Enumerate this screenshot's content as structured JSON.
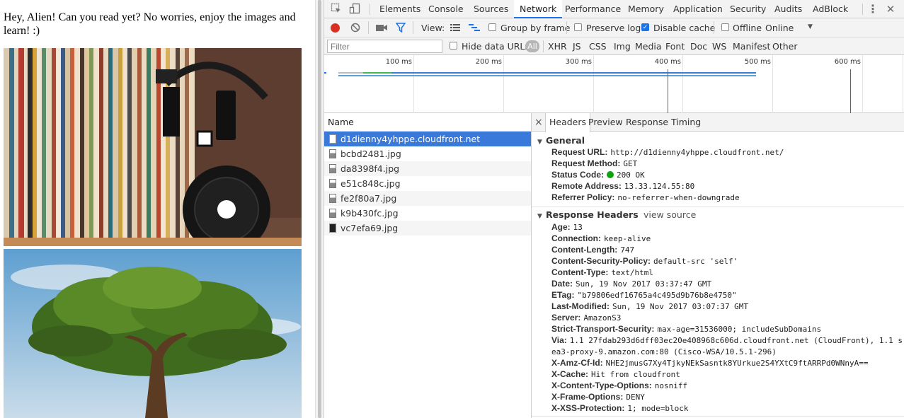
{
  "page": {
    "text": "Hey, Alien! Can you read yet? No worries, enjoy the images and learn! :)",
    "images": [
      "vinyl-records-and-headphones-photo",
      "tree-under-blue-sky-photo"
    ]
  },
  "devtools": {
    "panel_tabs": [
      "Elements",
      "Console",
      "Sources",
      "Network",
      "Performance",
      "Memory",
      "Application",
      "Security",
      "Audits",
      "AdBlock"
    ],
    "active_tab": "Network",
    "toolbar": {
      "view_label": "View:",
      "group_by_frame": "Group by frame",
      "preserve_log": "Preserve log",
      "disable_cache": "Disable cache",
      "offline": "Offline",
      "throttle": "Online"
    },
    "filter": {
      "placeholder": "Filter",
      "hide_data_urls": "Hide data URLs",
      "all": "All",
      "types": [
        "XHR",
        "JS",
        "CSS",
        "Img",
        "Media",
        "Font",
        "Doc",
        "WS",
        "Manifest",
        "Other"
      ]
    },
    "timeline_ticks": [
      "100 ms",
      "200 ms",
      "300 ms",
      "400 ms",
      "500 ms",
      "600 ms"
    ],
    "requests": {
      "header": "Name",
      "rows": [
        "d1dienny4yhppe.cloudfront.net",
        "bcbd2481.jpg",
        "da8398f4.jpg",
        "e51c848c.jpg",
        "fe2f80a7.jpg",
        "k9b430fc.jpg",
        "vc7efa69.jpg"
      ],
      "selected": 0
    },
    "details": {
      "close": "×",
      "tabs": [
        "Headers",
        "Preview",
        "Response",
        "Timing"
      ],
      "active_tab": "Headers",
      "general_title": "General",
      "general": [
        {
          "k": "Request URL:",
          "v": "http://d1dienny4yhppe.cloudfront.net/"
        },
        {
          "k": "Request Method:",
          "v": "GET"
        },
        {
          "k": "Status Code:",
          "v": "200 OK"
        },
        {
          "k": "Remote Address:",
          "v": "13.33.124.55:80"
        },
        {
          "k": "Referrer Policy:",
          "v": "no-referrer-when-downgrade"
        }
      ],
      "response_title": "Response Headers",
      "view_source": "view source",
      "response_headers": [
        {
          "k": "Age:",
          "v": "13"
        },
        {
          "k": "Connection:",
          "v": "keep-alive"
        },
        {
          "k": "Content-Length:",
          "v": "747"
        },
        {
          "k": "Content-Security-Policy:",
          "v": "default-src 'self'"
        },
        {
          "k": "Content-Type:",
          "v": "text/html"
        },
        {
          "k": "Date:",
          "v": "Sun, 19 Nov 2017 03:37:47 GMT"
        },
        {
          "k": "ETag:",
          "v": "\"b79806edf16765a4c495d9b76b8e4750\""
        },
        {
          "k": "Last-Modified:",
          "v": "Sun, 19 Nov 2017 03:07:37 GMT"
        },
        {
          "k": "Server:",
          "v": "AmazonS3"
        },
        {
          "k": "Strict-Transport-Security:",
          "v": "max-age=31536000; includeSubDomains"
        },
        {
          "k": "Via:",
          "v": "1.1 27fdab293d6dff03ec20e408968c606d.cloudfront.net (CloudFront), 1.1 s"
        },
        {
          "k": "",
          "v": "ea3-proxy-9.amazon.com:80 (Cisco-WSA/10.5.1-296)"
        },
        {
          "k": "X-Amz-Cf-Id:",
          "v": "NHE2jmusG7Xy4TjkyNEkSasntk8YUrkue2S4YXtC9ftARRPd0WNnyA=="
        },
        {
          "k": "X-Cache:",
          "v": "Hit from cloudfront"
        },
        {
          "k": "X-Content-Type-Options:",
          "v": "nosniff"
        },
        {
          "k": "X-Frame-Options:",
          "v": "DENY"
        },
        {
          "k": "X-XSS-Protection:",
          "v": "1; mode=block"
        }
      ]
    },
    "colors": {
      "accent": "#1a73e8",
      "record": "#d93025",
      "selected_row": "#3879d9",
      "status_ok": "#0fa20f"
    }
  }
}
